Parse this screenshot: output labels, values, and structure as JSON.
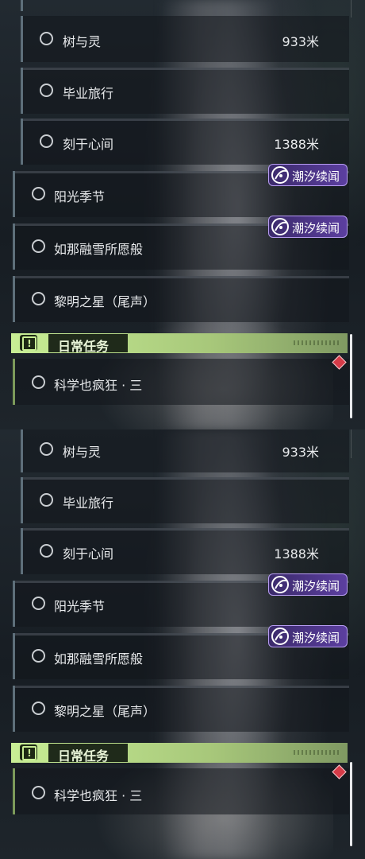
{
  "panels": [
    {
      "rows": [
        {
          "label": "树与灵",
          "distance": "933米"
        },
        {
          "label": "毕业旅行",
          "distance": ""
        },
        {
          "label": "刻于心间",
          "distance": "1388米"
        },
        {
          "label": "阳光季节",
          "tag": "潮汐续闻"
        },
        {
          "label": "如那融雪所愿般",
          "tag": "潮汐续闻"
        },
        {
          "label": "黎明之星（尾声）"
        }
      ],
      "section": {
        "title": "日常任务",
        "icon": "exclamation-icon"
      },
      "daily": [
        {
          "label": "科学也疯狂 · 三"
        }
      ]
    },
    {
      "rows": [
        {
          "label": "树与灵",
          "distance": "933米"
        },
        {
          "label": "毕业旅行",
          "distance": ""
        },
        {
          "label": "刻于心间",
          "distance": "1388米"
        },
        {
          "label": "阳光季节",
          "tag": "潮汐续闻"
        },
        {
          "label": "如那融雪所愿般",
          "tag": "潮汐续闻"
        },
        {
          "label": "黎明之星（尾声）"
        }
      ],
      "section": {
        "title": "日常任务",
        "icon": "exclamation-icon"
      },
      "daily": [
        {
          "label": "科学也疯狂 · 三"
        }
      ]
    }
  ],
  "colors": {
    "accent_green": "#c8ee95",
    "tag_purple": "#5c3fa0",
    "marker_red": "#d63b48"
  }
}
